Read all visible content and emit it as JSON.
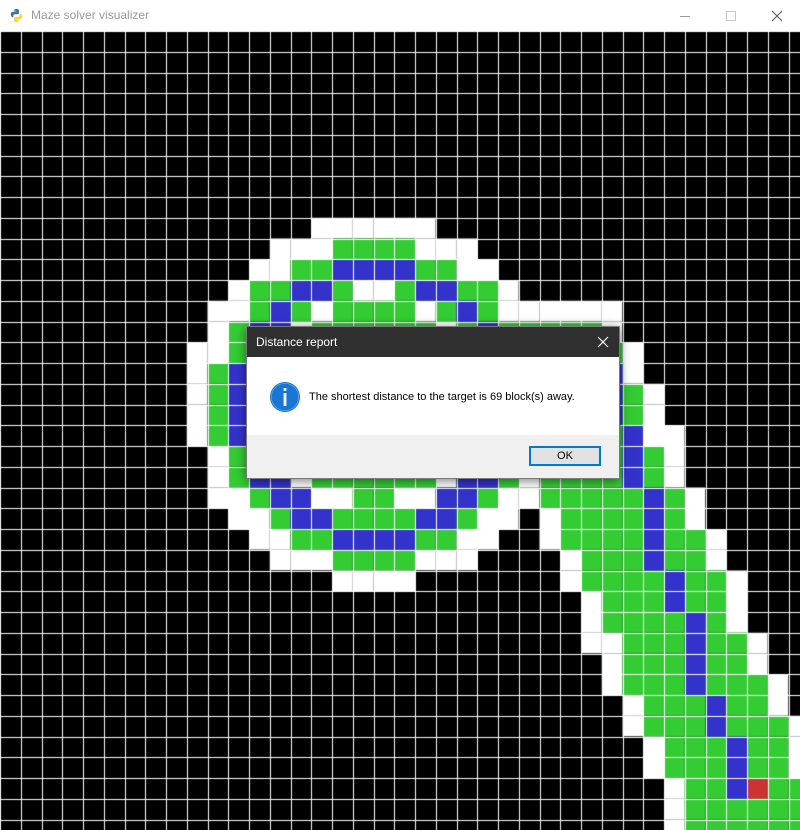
{
  "window": {
    "title": "Maze solver visualizer",
    "minimize_icon": "minimize-icon",
    "maximize_icon": "maximize-icon",
    "close_icon": "close-icon"
  },
  "maze": {
    "colors": {
      "wall": "#000000",
      "open": "#ffffff",
      "visited": "#33cc33",
      "path": "#3333cc",
      "target": "#cc3333",
      "gridline": "#ffffff"
    }
  },
  "dialog": {
    "title": "Distance report",
    "message": "The shortest distance to the target is 69 block(s) away.",
    "ok_label": "OK",
    "icon": "info-icon"
  }
}
